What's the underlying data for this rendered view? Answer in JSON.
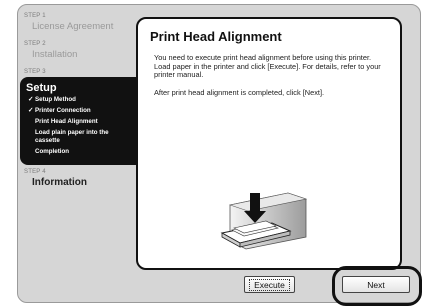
{
  "sidebar": {
    "step1": {
      "heading": "STEP 1",
      "label": "License Agreement"
    },
    "step2": {
      "heading": "STEP 2",
      "label": "Installation"
    },
    "step3": {
      "heading": "STEP 3",
      "title": "Setup",
      "items": [
        {
          "label": "Setup Method",
          "checked": true
        },
        {
          "label": "Printer Connection",
          "checked": true
        },
        {
          "label": "Print Head Alignment",
          "checked": false
        },
        {
          "label": "Load plain paper into the cassette",
          "checked": false
        },
        {
          "label": "Completion",
          "checked": false
        }
      ],
      "check_glyph": "✓"
    },
    "step4": {
      "heading": "STEP 4",
      "label": "Information"
    }
  },
  "main": {
    "title": "Print Head Alignment",
    "paragraph1": "You need to execute print head alignment before using this printer. Load paper in the printer and click [Execute]. For details, refer to your printer manual.",
    "paragraph2": "After print head alignment is completed, click [Next].",
    "illustration_icon": "printer-paper-insert-icon"
  },
  "buttons": {
    "execute_label": "Execute",
    "next_label": "Next"
  }
}
